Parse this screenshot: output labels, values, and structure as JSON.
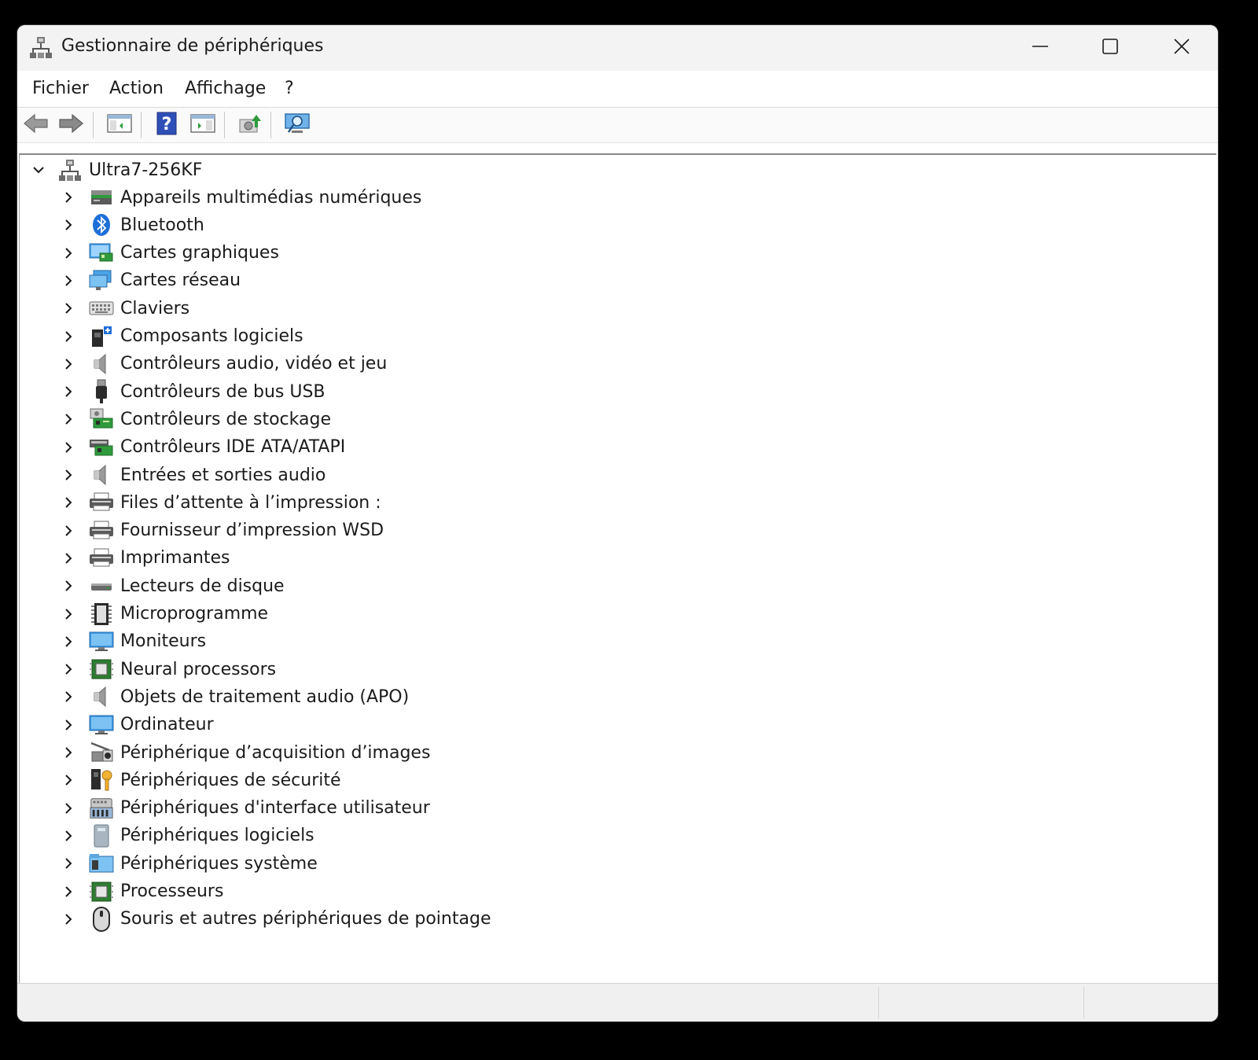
{
  "window": {
    "title": "Gestionnaire de périphériques",
    "controls": {
      "minimize": "minimize-icon",
      "maximize": "maximize-icon",
      "close": "close-icon"
    }
  },
  "menubar": {
    "items": [
      "Fichier",
      "Action",
      "Affichage",
      "?"
    ]
  },
  "toolbar": {
    "buttons": [
      "back-arrow-icon",
      "forward-arrow-icon",
      "console-tree-icon",
      "help-icon",
      "action-pane-icon",
      "update-driver-icon",
      "scan-hardware-icon"
    ]
  },
  "tree": {
    "root": {
      "label": "Ultra7-256KF",
      "icon": "computer-icon",
      "expanded": true
    },
    "items": [
      {
        "label": "Appareils multimédias numériques",
        "icon": "multimedia-device-icon"
      },
      {
        "label": "Bluetooth",
        "icon": "bluetooth-icon"
      },
      {
        "label": "Cartes graphiques",
        "icon": "display-adapter-icon"
      },
      {
        "label": "Cartes réseau",
        "icon": "network-adapter-icon"
      },
      {
        "label": "Claviers",
        "icon": "keyboard-icon"
      },
      {
        "label": "Composants logiciels",
        "icon": "software-component-icon"
      },
      {
        "label": "Contrôleurs audio, vidéo et jeu",
        "icon": "speaker-icon"
      },
      {
        "label": "Contrôleurs de bus USB",
        "icon": "usb-icon"
      },
      {
        "label": "Contrôleurs de stockage",
        "icon": "storage-controller-icon"
      },
      {
        "label": "Contrôleurs IDE ATA/ATAPI",
        "icon": "ide-controller-icon"
      },
      {
        "label": "Entrées et sorties audio",
        "icon": "speaker-icon"
      },
      {
        "label": "Files d’attente à l’impression :",
        "icon": "printer-icon"
      },
      {
        "label": "Fournisseur d’impression WSD",
        "icon": "printer-icon"
      },
      {
        "label": "Imprimantes",
        "icon": "printer-icon"
      },
      {
        "label": "Lecteurs de disque",
        "icon": "disk-drive-icon"
      },
      {
        "label": "Microprogramme",
        "icon": "firmware-chip-icon"
      },
      {
        "label": "Moniteurs",
        "icon": "monitor-icon"
      },
      {
        "label": "Neural processors",
        "icon": "processor-chip-icon"
      },
      {
        "label": "Objets de traitement audio (APO)",
        "icon": "speaker-icon"
      },
      {
        "label": "Ordinateur",
        "icon": "monitor-icon"
      },
      {
        "label": "Périphérique d’acquisition d’images",
        "icon": "camera-icon"
      },
      {
        "label": "Périphériques de sécurité",
        "icon": "security-key-icon"
      },
      {
        "label": "Périphériques d'interface utilisateur",
        "icon": "hid-icon"
      },
      {
        "label": "Périphériques logiciels",
        "icon": "software-device-icon"
      },
      {
        "label": "Périphériques système",
        "icon": "system-folder-icon"
      },
      {
        "label": "Processeurs",
        "icon": "processor-chip-icon"
      },
      {
        "label": "Souris et autres périphériques de pointage",
        "icon": "mouse-icon"
      }
    ]
  },
  "colors": {
    "accent": "#2a7bd4",
    "green": "#2e9a3c",
    "titlebar": "#f3f3f3"
  }
}
